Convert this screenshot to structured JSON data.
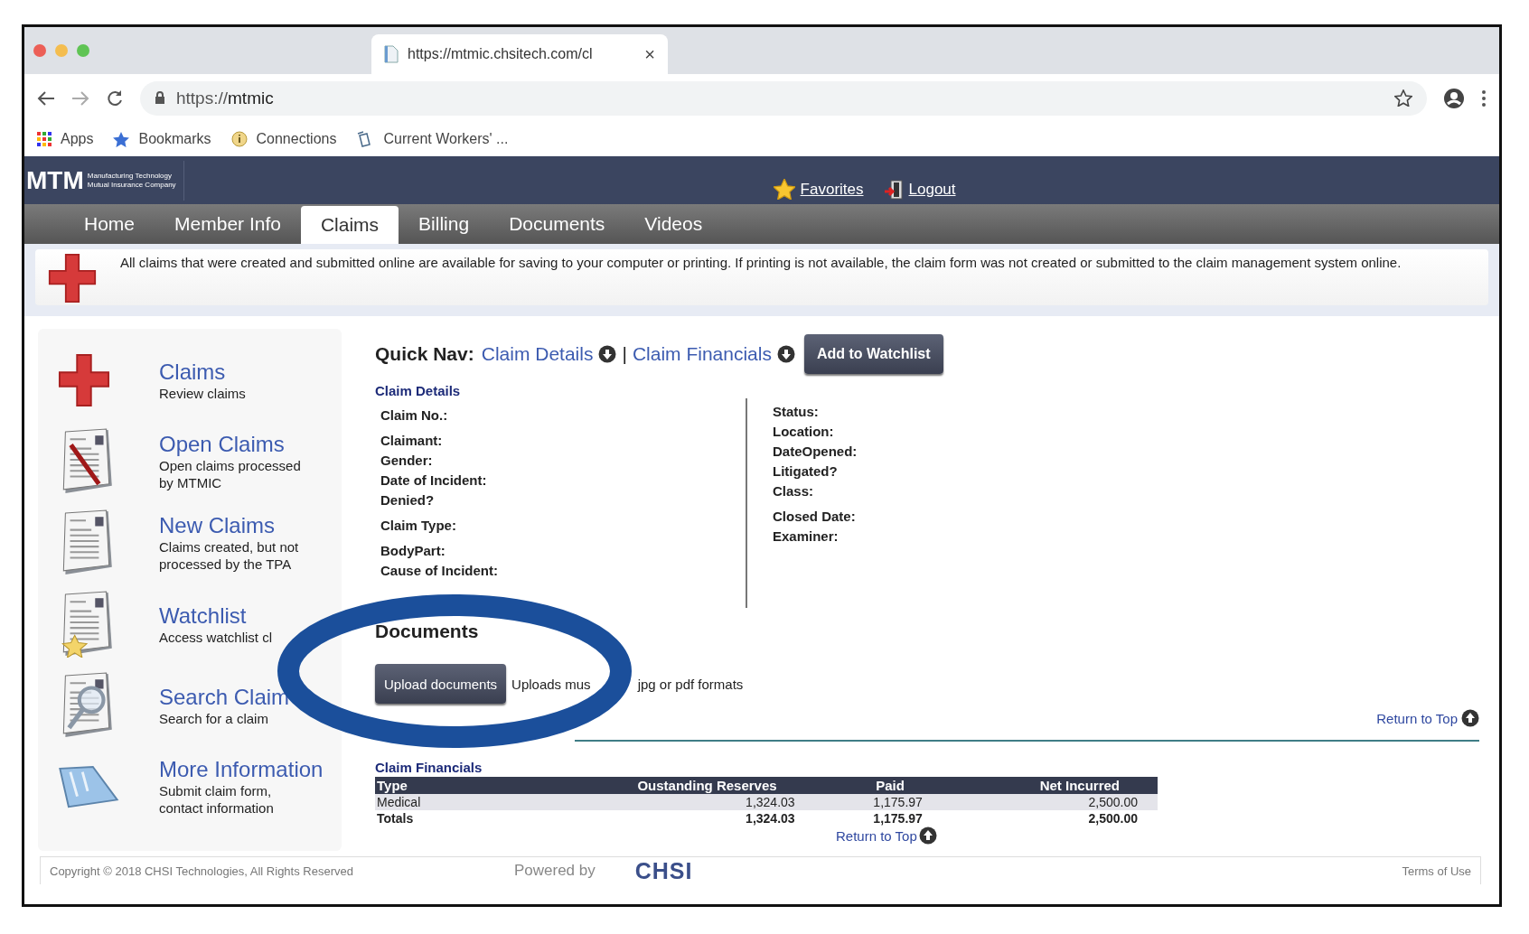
{
  "browser": {
    "tab_title": "https://mtmic.chsitech.com/cl",
    "tab_close": "×",
    "url_scheme": "https://",
    "url_host": "mtmic",
    "bookmarks": [
      {
        "kind": "apps",
        "label": "Apps"
      },
      {
        "kind": "star",
        "label": "Bookmarks"
      },
      {
        "kind": "info",
        "label": "Connections"
      },
      {
        "kind": "page",
        "label": "Current Workers' ..."
      }
    ]
  },
  "header": {
    "logo": "MTM",
    "logo_lines": [
      "Manufacturing Technology",
      "Mutual Insurance Company"
    ],
    "links": [
      {
        "kind": "star",
        "label": "Favorites"
      },
      {
        "kind": "exit",
        "label": "Logout"
      }
    ]
  },
  "nav": [
    {
      "label": "Home",
      "selected": false
    },
    {
      "label": "Member Info",
      "selected": false
    },
    {
      "label": "Claims",
      "selected": true
    },
    {
      "label": "Billing",
      "selected": false
    },
    {
      "label": "Documents",
      "selected": false
    },
    {
      "label": "Videos",
      "selected": false
    }
  ],
  "notice": "All claims that were created and submitted online are available for saving to your computer or printing. If printing is not available, the claim form was not created or submitted to the claim management system online.",
  "sidebar": {
    "items": [
      {
        "kind": "cross",
        "title": "Claims",
        "subtitle": "Review claims"
      },
      {
        "kind": "document-stripe",
        "title": "Open Claims",
        "subtitle": "Open claims processed by MTMIC"
      },
      {
        "kind": "document",
        "title": "New Claims",
        "subtitle": "Claims created, but not processed by the TPA"
      },
      {
        "kind": "document-star",
        "title": "Watchlist",
        "subtitle": "Access watchlist cl"
      },
      {
        "kind": "document-magnifier",
        "title": "Search Claim",
        "subtitle": "Search for a claim"
      },
      {
        "kind": "window",
        "title": "More Information",
        "subtitle": "Submit claim form, contact information"
      }
    ]
  },
  "quick_nav": {
    "label": "Quick Nav:",
    "links": [
      "Claim Details",
      "Claim Financials"
    ],
    "separator": "|",
    "button": "Add to Watchlist"
  },
  "claim_details": {
    "heading": "Claim Details",
    "left_fields": [
      "Claim No.:",
      "Claimant:",
      "Gender:",
      "Date of Incident:",
      "Denied?",
      "Claim Type:",
      "BodyPart:",
      "Cause of Incident:"
    ],
    "right_fields": [
      "Status:",
      "Location:",
      "DateOpened:",
      "Litigated?",
      "Class:",
      "Closed Date:",
      "Examiner:"
    ]
  },
  "documents": {
    "heading": "Documents",
    "button": "Upload documents",
    "note_parts": [
      "Uploads mus",
      "jpg or pdf formats"
    ],
    "return_link": "Return to Top"
  },
  "claim_financials": {
    "heading": "Claim Financials",
    "columns": [
      "Type",
      "Oustanding Reserves",
      "Paid",
      "Net Incurred"
    ],
    "rows": [
      {
        "kind": "line",
        "cells": [
          "Medical",
          "1,324.03",
          "1,175.97",
          "2,500.00"
        ]
      },
      {
        "kind": "total",
        "cells": [
          "Totals",
          "1,324.03",
          "1,175.97",
          "2,500.00"
        ]
      }
    ],
    "return_link": "Return to Top"
  },
  "footer": {
    "copyright": "Copyright © 2018 CHSI Technologies, All Rights Reserved",
    "powered_by": "Powered by",
    "brand": "CHSI",
    "terms": "Terms of Use"
  }
}
